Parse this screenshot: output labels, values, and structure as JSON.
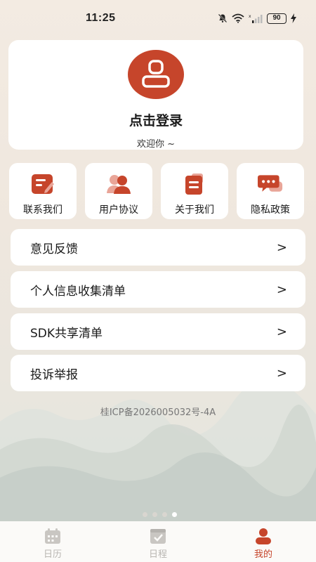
{
  "status_bar": {
    "time": "11:25",
    "battery": "90"
  },
  "profile": {
    "title": "点击登录",
    "subtitle": "欢迎你 ~"
  },
  "quick_actions": [
    {
      "label": "联系我们",
      "icon": "edit-note-icon"
    },
    {
      "label": "用户协议",
      "icon": "users-icon"
    },
    {
      "label": "关于我们",
      "icon": "document-icon"
    },
    {
      "label": "隐私政策",
      "icon": "chat-bubble-icon"
    }
  ],
  "menu": [
    {
      "label": "意见反馈",
      "chevron": ">"
    },
    {
      "label": "个人信息收集清单",
      "chevron": ">"
    },
    {
      "label": "SDK共享清单",
      "chevron": ">"
    },
    {
      "label": "投诉举报",
      "chevron": ">"
    }
  ],
  "icp": "桂ICP备2026005032号-4A",
  "tabs": [
    {
      "label": "日历",
      "icon": "calendar-icon",
      "active": false
    },
    {
      "label": "日程",
      "icon": "schedule-icon",
      "active": false
    },
    {
      "label": "我的",
      "icon": "profile-icon",
      "active": true
    }
  ],
  "colors": {
    "accent": "#c6452b",
    "inactive": "#b9b6b2",
    "card": "#ffffff"
  }
}
